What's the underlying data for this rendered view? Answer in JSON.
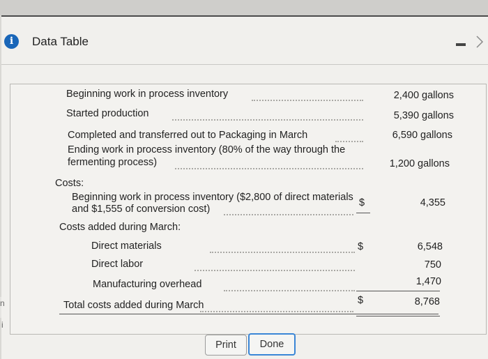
{
  "window": {
    "title": "Data Table",
    "info_icon": "i"
  },
  "rows": {
    "beg_wip": {
      "label": "Beginning work in process inventory",
      "value": "2,400 gallons"
    },
    "started": {
      "label": "Started production",
      "value": "5,390 gallons"
    },
    "completed": {
      "label": "Completed and transferred out to Packaging in March",
      "value": "6,590 gallons"
    },
    "end_wip": {
      "label_line1": "Ending work in process inventory (80% of the way through the",
      "label_line2": "fermenting process)",
      "value": "1,200 gallons"
    }
  },
  "costs": {
    "heading": "Costs:",
    "beg_wip": {
      "label_line1": "Beginning work in process inventory ($2,800 of direct materials",
      "label_line2": "and $1,555 of conversion cost)",
      "currency": "$",
      "value": "4,355"
    },
    "added_heading": "Costs added during March:",
    "direct_materials": {
      "label": "Direct materials",
      "currency": "$",
      "value": "6,548"
    },
    "direct_labor": {
      "label": "Direct labor",
      "value": "750"
    },
    "overhead": {
      "label": "Manufacturing overhead",
      "value": "1,470"
    },
    "total": {
      "label": "Total costs added during March",
      "currency": "$",
      "value": "8,768"
    }
  },
  "buttons": {
    "print": "Print",
    "done": "Done"
  },
  "edge_text": {
    "a": "n",
    "b": "i"
  }
}
